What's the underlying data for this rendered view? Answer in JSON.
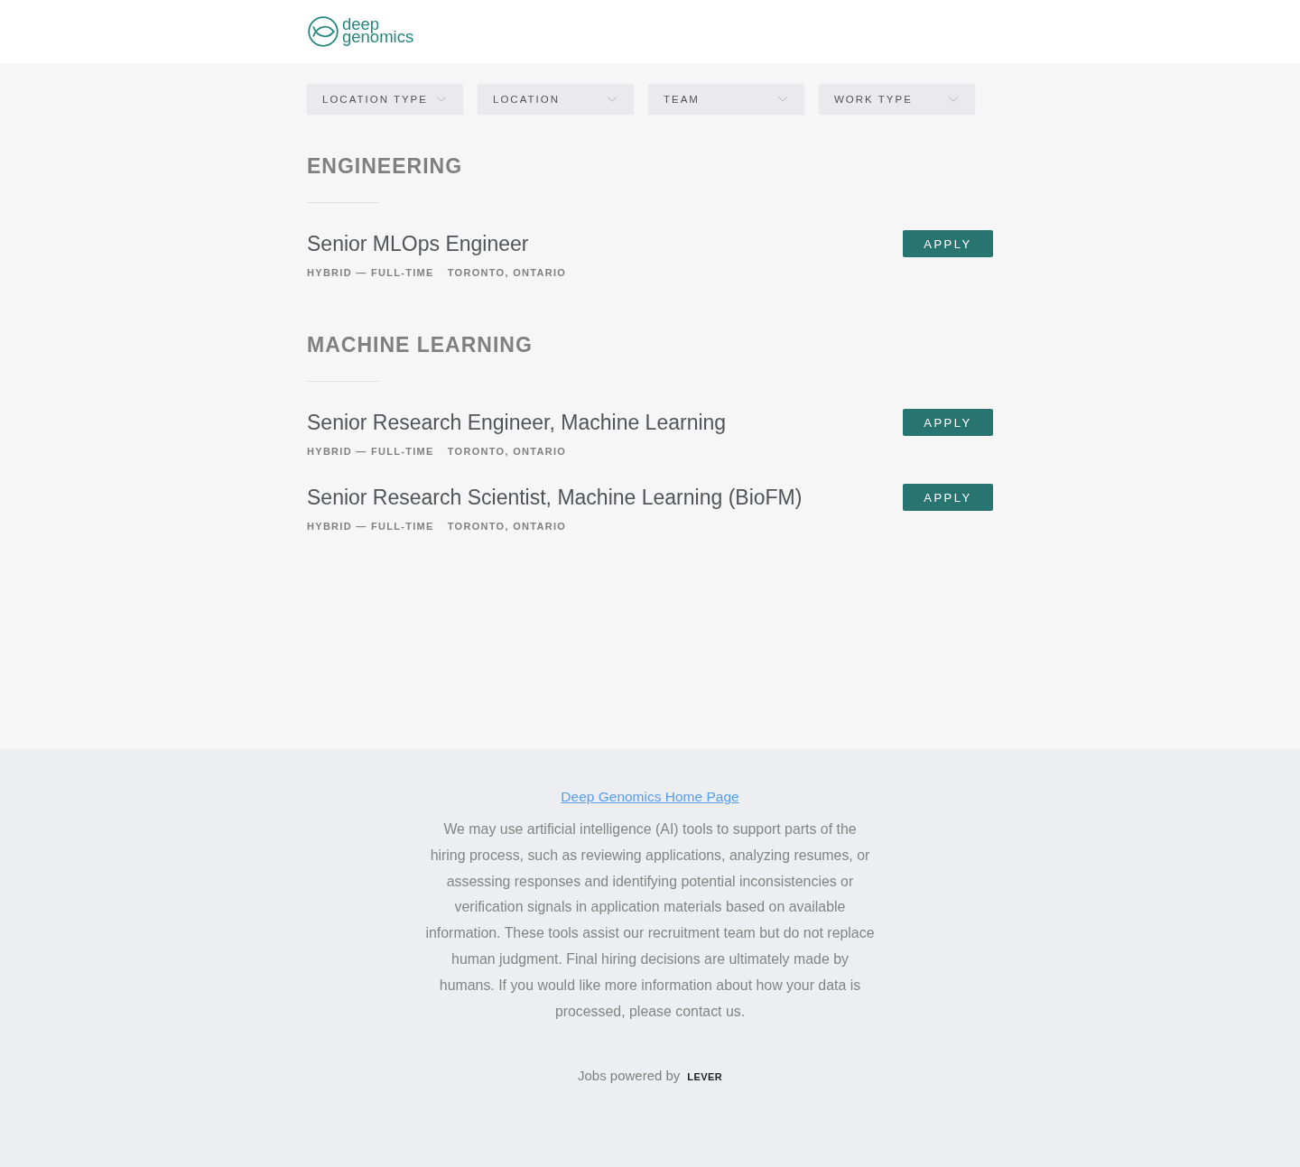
{
  "header": {
    "logo_text": "deep genomics"
  },
  "filters": [
    {
      "label": "LOCATION TYPE"
    },
    {
      "label": "LOCATION"
    },
    {
      "label": "TEAM"
    },
    {
      "label": "WORK TYPE"
    }
  ],
  "sections": [
    {
      "title": "ENGINEERING",
      "jobs": [
        {
          "title": "Senior MLOps Engineer",
          "commitment": "HYBRID — FULL-TIME",
          "location": "TORONTO, ONTARIO",
          "button": "APPLY"
        }
      ]
    },
    {
      "title": "MACHINE LEARNING",
      "jobs": [
        {
          "title": "Senior Research Engineer, Machine Learning",
          "commitment": "HYBRID — FULL-TIME",
          "location": "TORONTO, ONTARIO",
          "button": "APPLY"
        },
        {
          "title": "Senior Research Scientist, Machine Learning (BioFM)",
          "commitment": "HYBRID — FULL-TIME",
          "location": "TORONTO, ONTARIO",
          "button": "APPLY"
        }
      ]
    }
  ],
  "footer": {
    "link": "Deep Genomics Home Page",
    "notice": "We may use artificial intelligence (AI) tools to support parts of the hiring process, such as reviewing applications, analyzing resumes, or assessing responses and identifying potential inconsistencies or verification signals in application materials based on available information. These tools assist our recruitment team but do not replace human judgment. Final hiring decisions are ultimately made by humans. If you would like more information about how your data is processed, please contact us.",
    "powered_by": "Jobs powered by",
    "brand": "LEVER"
  }
}
